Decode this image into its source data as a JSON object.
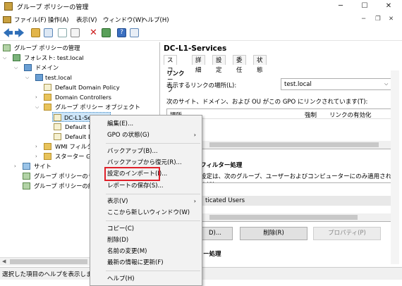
{
  "window": {
    "title": "グループ ポリシーの管理",
    "minimize": "─",
    "maximize": "☐",
    "close": "✕",
    "inner_minimize": "─",
    "inner_restore": "❐",
    "inner_close": "✕"
  },
  "menu": [
    "ファイル(F)",
    "操作(A)",
    "表示(V)",
    "ウィンドウ(W)",
    "ヘルプ(H)"
  ],
  "tree": {
    "root": "グループ ポリシーの管理",
    "forest": "フォレスト: test.local",
    "domains": "ドメイン",
    "domain": "test.local",
    "default_policy": "Default Domain Policy",
    "domain_controllers": "Domain Controllers",
    "gpo_folder": "グループ ポリシー オブジェクト",
    "gpo_selected": "DC-L1-Services",
    "gpo_def1": "Default D",
    "gpo_def2": "Default D",
    "wmi": "WMI フィルター",
    "starter": "スターター GPO",
    "sites": "サイト",
    "modeling": "グループ ポリシーのモデ",
    "results": "グループ ポリシーの結果"
  },
  "status": "選択した項目のヘルプを表示します",
  "right": {
    "title": "DC-L1-Services",
    "tabs": [
      "スコープ",
      "詳細",
      "設定",
      "委任",
      "状態"
    ],
    "links_heading": "リンク",
    "location_label": "表示するリンクの場所(L):",
    "location_value": "test.local",
    "links_desc": "次のサイト、ドメイン、および OU がこの GPO にリンクされています(T):",
    "col_location": "場所",
    "col_enforced": "強制",
    "col_enabled": "リンクの有効化",
    "filter_heading": "フィルター処理",
    "filter_desc": "設定は、次のグループ、ユーザーおよびコンピューターにのみ適用されます(S):",
    "filter_item": "ticated Users",
    "btn_add": "D)...",
    "btn_remove": "削除(R)",
    "btn_props": "プロパティ(P)",
    "wmi_heading": "ー処理"
  },
  "context_menu": {
    "edit": "編集(E)...",
    "gpo_status": "GPO の状態(G)",
    "backup": "バックアップ(B)...",
    "restore": "バックアップから復元(R)...",
    "import": "設定のインポート(I)...",
    "save_report": "レポートの保存(S)...",
    "view": "表示(V)",
    "new_window": "ここから新しいウィンドウ(W)",
    "copy": "コピー(C)",
    "delete": "削除(D)",
    "rename": "名前の変更(M)",
    "refresh": "最新の情報に更新(F)",
    "help": "ヘルプ(H)",
    "submenu_arrow": "›"
  },
  "colors": {
    "highlight": "#e0202a",
    "selection": "#cce4f7"
  }
}
